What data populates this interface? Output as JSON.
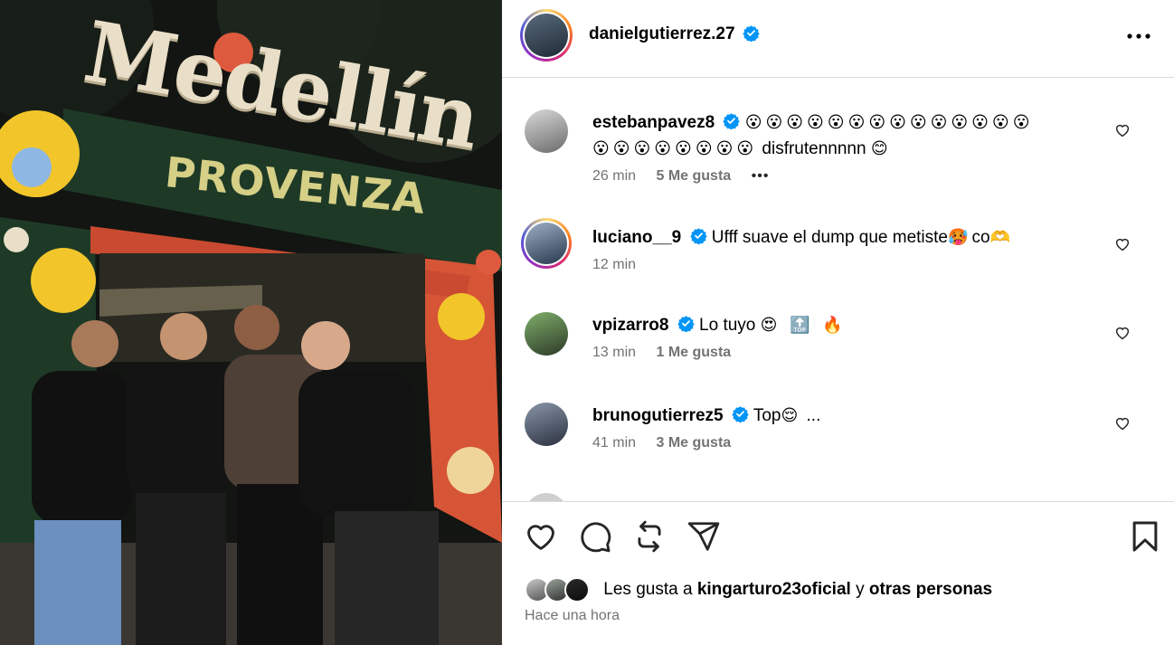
{
  "post": {
    "author": "danielgutierrez.27",
    "photo": {
      "sign_word": "Medellín",
      "arch_label": "PROVENZA"
    }
  },
  "comments": [
    {
      "user": "estebanpavez8",
      "verified": true,
      "emoji_line1": "😮😮😮😮😮😮😮😮😮😮😮😮😮😮",
      "emoji_line2": "😮😮😮😮😮😮😮😮",
      "text": "disfrutennnnn",
      "trailing_emoji": "😊",
      "time": "26 min",
      "likes": "5 Me gusta",
      "more": "•••",
      "avatar_icon": "user-avatar"
    },
    {
      "user": "luciano__9",
      "verified": true,
      "text": "Ufff suave el dump que metiste",
      "emoji_a": "🥵",
      "text2": "co",
      "emoji_b": "🫶",
      "time": "12 min",
      "avatar_icon": "user-avatar"
    },
    {
      "user": "vpizarro8",
      "verified": true,
      "text": "Lo tuyo",
      "emojis": "😍 🔝 🔥",
      "time": "13 min",
      "likes": "1 Me gusta",
      "avatar_icon": "user-avatar"
    },
    {
      "user": "brunogutierrez5",
      "verified": true,
      "text": "Top",
      "emoji": "😌",
      "ellipsis": "...",
      "time": "41 min",
      "likes": "3 Me gusta",
      "avatar_icon": "user-avatar"
    }
  ],
  "actions": {
    "like_icon": "heart-icon",
    "comment_icon": "comment-icon",
    "repost_icon": "repost-icon",
    "share_icon": "share-icon",
    "save_icon": "bookmark-icon"
  },
  "likes_summary": {
    "prefix": "Les gusta a",
    "user": "kingarturo23oficial",
    "connector": "y",
    "others": "otras personas"
  },
  "posted": "Hace una hora",
  "colors": {
    "verified": "#0095f6",
    "meta_text": "#737373",
    "divider": "#dbdbdb"
  }
}
